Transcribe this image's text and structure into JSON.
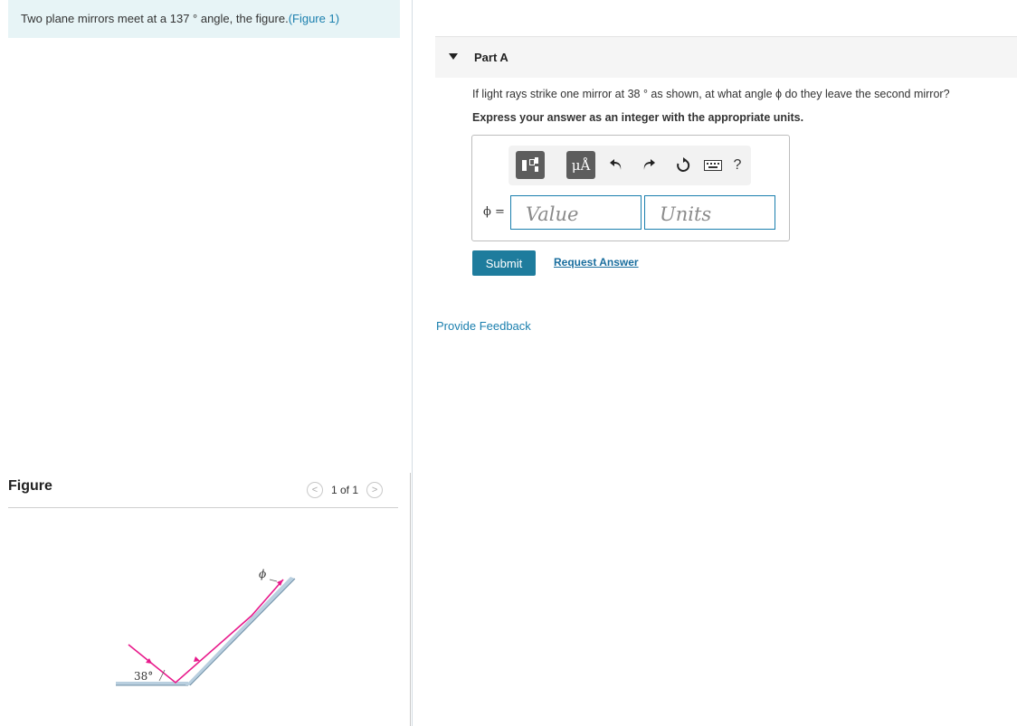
{
  "problem": {
    "intro_text": "Two plane mirrors meet at a 137 ° angle, the figure.",
    "figure_link": "(Figure 1)"
  },
  "figure_panel": {
    "heading": "Figure",
    "counter": "1 of 1",
    "prev_glyph": "<",
    "next_glyph": ">",
    "angle_label": "38°",
    "phi_label": "ϕ"
  },
  "part": {
    "title": "Part A",
    "question": "If light rays strike one mirror at 38 ° as shown, at what angle ϕ do they leave the second mirror?",
    "instruction": "Express your answer as an integer with the appropriate units."
  },
  "answer": {
    "variable_label": "ϕ =",
    "value_placeholder": "Value",
    "units_placeholder": "Units",
    "units_button_label": "μÅ",
    "help_label": "?"
  },
  "actions": {
    "submit_label": "Submit",
    "request_answer_label": "Request Answer",
    "feedback_label": "Provide Feedback"
  },
  "colors": {
    "accent": "#1a7fae",
    "submit_bg": "#1e7c9d",
    "ray": "#e8198b",
    "mirror": "#8fb4cf"
  }
}
